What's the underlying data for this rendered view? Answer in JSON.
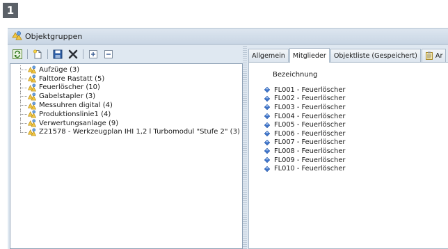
{
  "step_badge": "1",
  "window": {
    "title": "Objektgruppen"
  },
  "toolbar": {
    "buttons": [
      {
        "icon": "refresh-icon"
      },
      {
        "icon": "new-document-icon"
      },
      {
        "icon": "save-icon"
      },
      {
        "icon": "delete-icon"
      },
      {
        "icon": "expand-all-icon"
      },
      {
        "icon": "collapse-all-icon"
      }
    ]
  },
  "tree": {
    "items": [
      {
        "label": "Aufzüge (3)"
      },
      {
        "label": "Falttore Rastatt (5)"
      },
      {
        "label": "Feuerlöscher (10)"
      },
      {
        "label": "Gabelstapler (3)"
      },
      {
        "label": "Messuhren digital (4)"
      },
      {
        "label": "Produktionslinie1 (4)"
      },
      {
        "label": "Verwertungsanlage (9)"
      },
      {
        "label": "Z21578 - Werkzeugplan IHI 1,2 l Turbomodul \"Stufe 2\" (3)"
      }
    ]
  },
  "tabs": [
    {
      "label": "Allgemein",
      "active": false
    },
    {
      "label": "Mitglieder",
      "active": true
    },
    {
      "label": "Objektliste (Gespeichert)",
      "active": false
    },
    {
      "label": "Ar",
      "active": false
    }
  ],
  "members": {
    "column_header": "Bezeichnung",
    "items": [
      {
        "label": "FL001 - Feuerlöscher"
      },
      {
        "label": "FL002 - Feuerlöscher"
      },
      {
        "label": "FL003 - Feuerlöscher"
      },
      {
        "label": "FL004 - Feuerlöscher"
      },
      {
        "label": "FL005 - Feuerlöscher"
      },
      {
        "label": "FL006 - Feuerlöscher"
      },
      {
        "label": "FL007 - Feuerlöscher"
      },
      {
        "label": "FL008 - Feuerlöscher"
      },
      {
        "label": "FL009 - Feuerlöscher"
      },
      {
        "label": "FL010 - Feuerlöscher"
      }
    ]
  }
}
